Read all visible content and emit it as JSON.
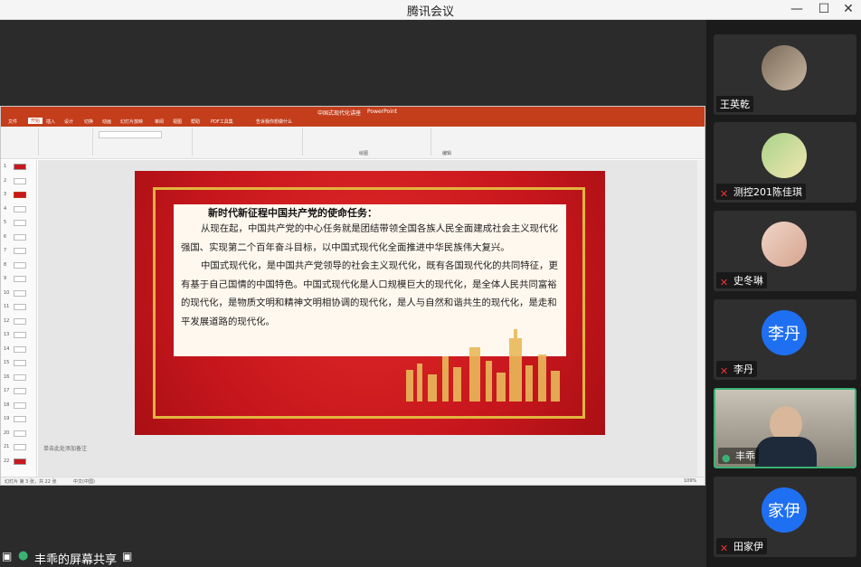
{
  "window": {
    "title": "腾讯会议"
  },
  "share": {
    "label": "丰乖的屏幕共享",
    "app": {
      "doc_title": "中国式现代化讲座",
      "app_name": "PowerPoint",
      "ribbon_group_labels": [
        "绘图",
        "编辑"
      ]
    },
    "tabs": [
      "文件",
      "开始",
      "插入",
      "设计",
      "切换",
      "动画",
      "幻灯片放映",
      "审阅",
      "视图",
      "帮助",
      "PDF工具集",
      "告诉我你想做什么"
    ],
    "slide": {
      "heading": "新时代新征程中国共产党的使命任务：",
      "para1": "从现在起，中国共产党的中心任务就是团结带领全国各族人民全面建成社会主义现代化强国、实现第二个百年奋斗目标，以中国式现代化全面推进中华民族伟大复兴。",
      "para2": "中国式现代化，是中国共产党领导的社会主义现代化，既有各国现代化的共同特征，更有基于自己国情的中国特色。中国式现代化是人口规模巨大的现代化，是全体人民共同富裕的现代化，是物质文明和精神文明相协调的现代化，是人与自然和谐共生的现代化，是走和平发展道路的现代化。"
    },
    "notes_placeholder": "单击此处添加备注",
    "thumb_count": 22,
    "status": {
      "left": "幻灯片 第 3 张，共 22 张",
      "lang": "中文(中国)",
      "zoom": "109%"
    }
  },
  "participants": [
    {
      "name": "王英乾",
      "avatar": "photo",
      "muted": false
    },
    {
      "name": "测控201陈佳琪",
      "avatar": "photo",
      "muted": true
    },
    {
      "name": "史冬琳",
      "avatar": "photo",
      "muted": true
    },
    {
      "name": "李丹",
      "avatar_text": "李丹",
      "muted": true
    },
    {
      "name": "丰乖",
      "avatar": "video",
      "muted": false,
      "active": true
    },
    {
      "name": "田家伊",
      "avatar_text": "家伊",
      "muted": true
    }
  ],
  "colors": {
    "accent_green": "#3bb273",
    "avatar_blue": "#1e6ff1",
    "ppt_red": "#c43e1c"
  }
}
